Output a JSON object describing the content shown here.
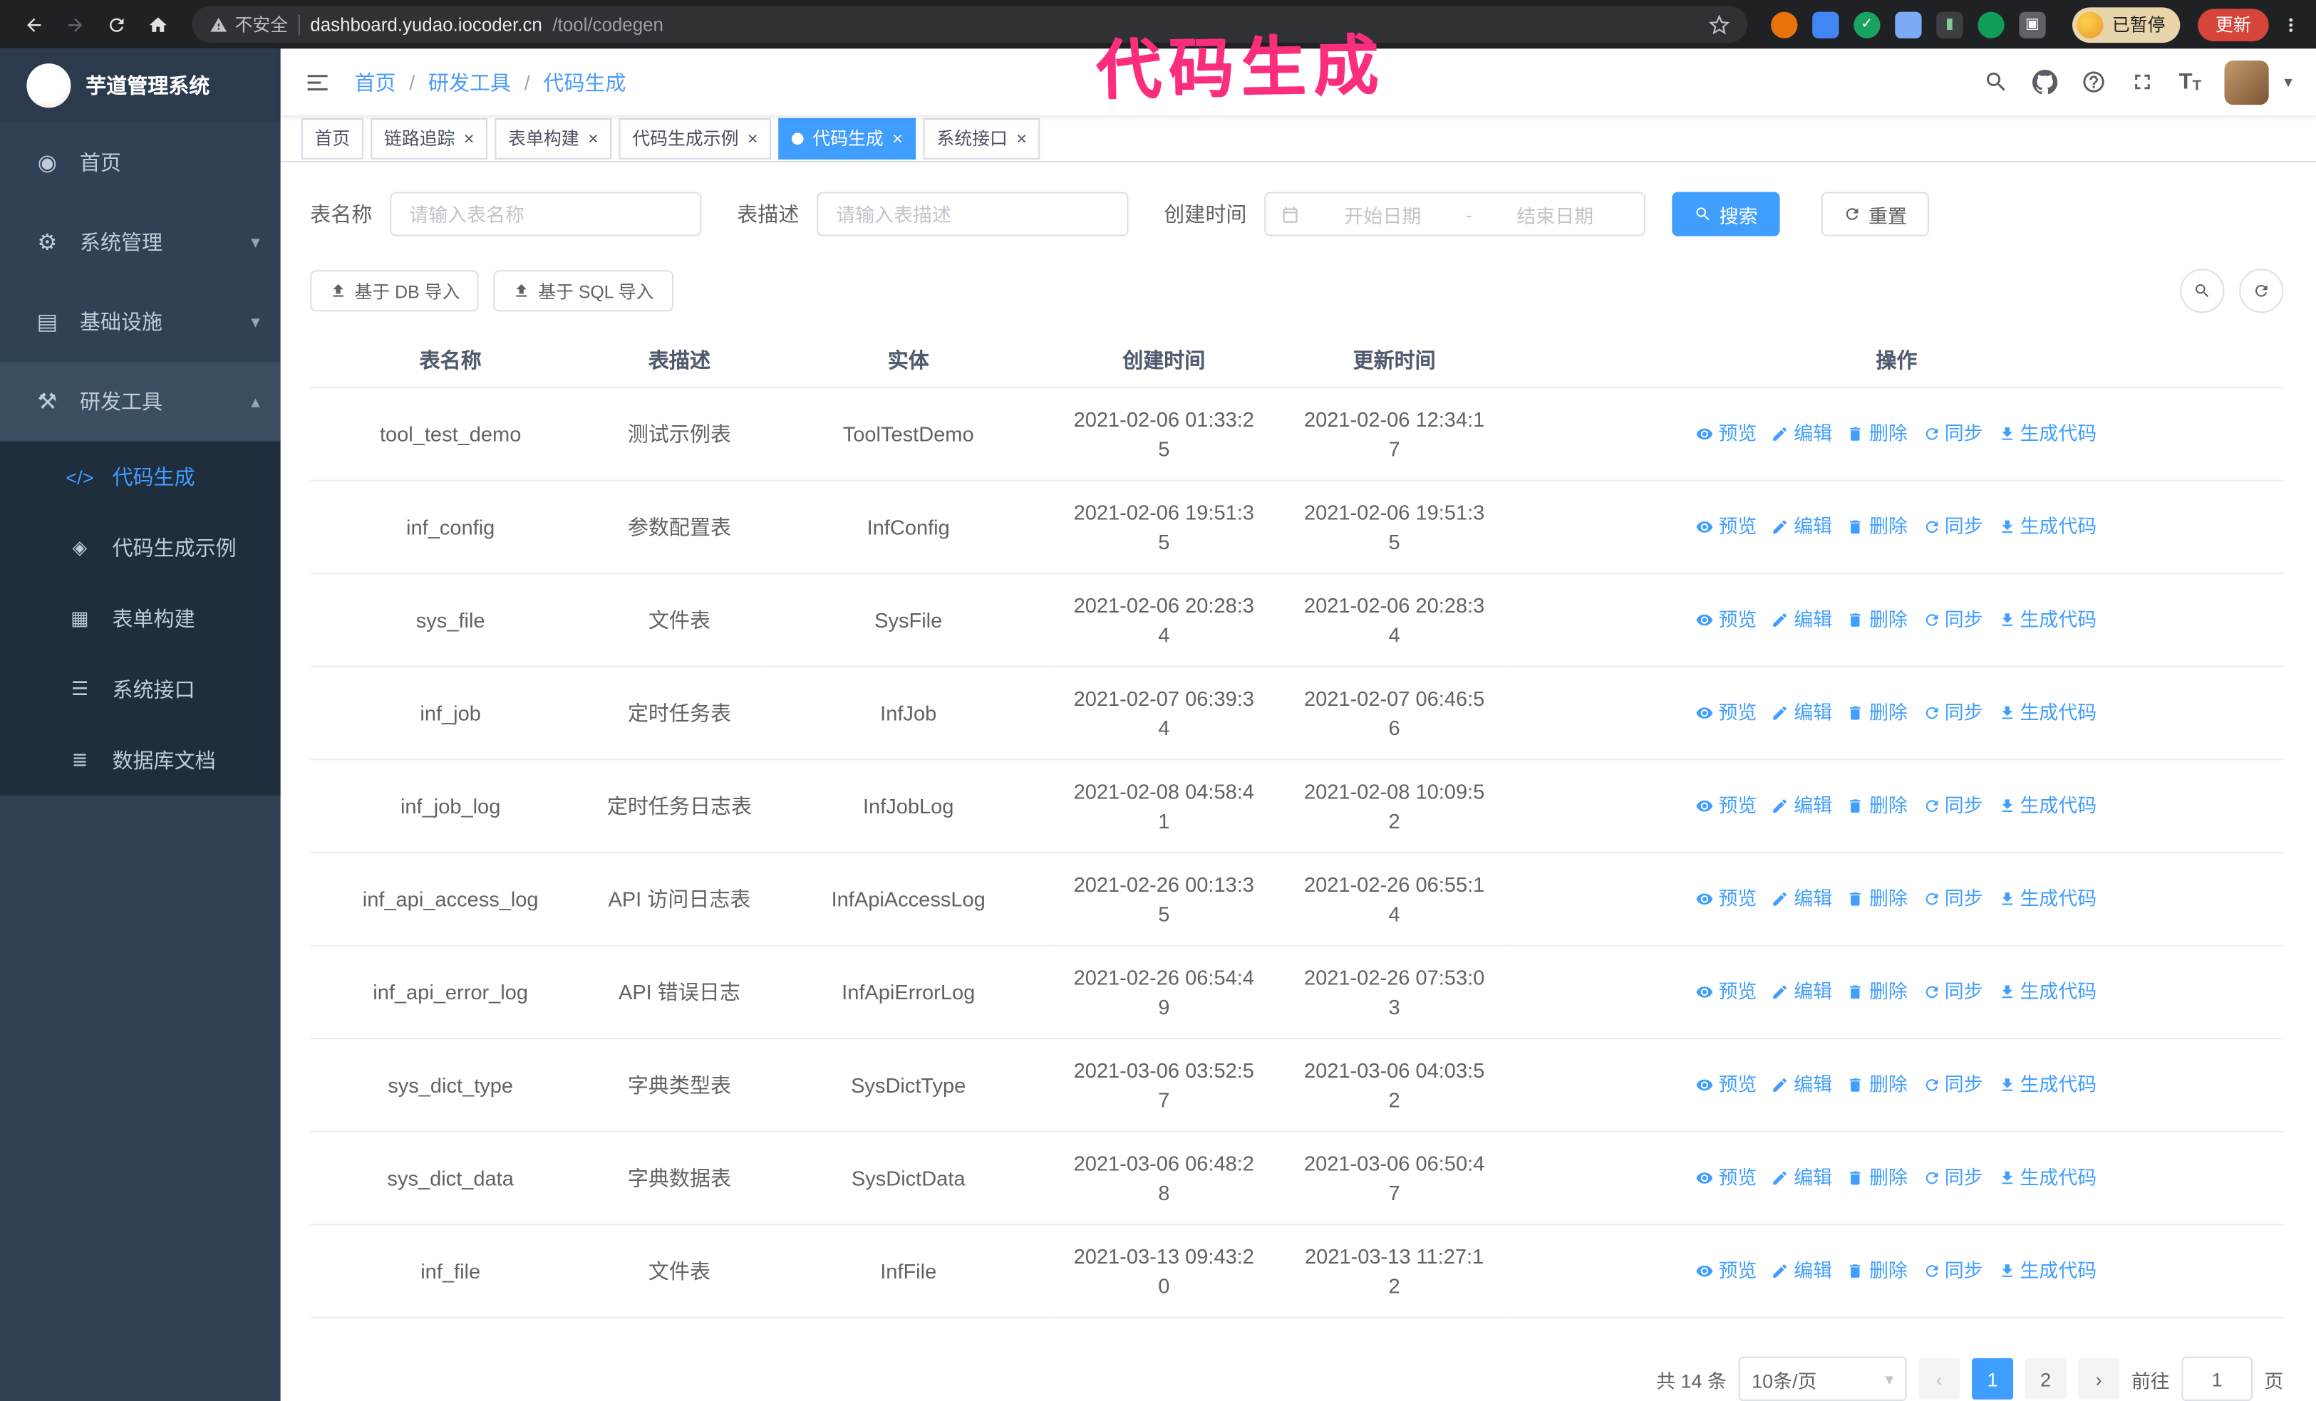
{
  "annotation": {
    "text": "代码生成",
    "color": "#fb2e7d"
  },
  "browser": {
    "security_label": "不安全",
    "url_host": "dashboard.yudao.iocoder.cn",
    "url_path": "/tool/codegen",
    "paused_badge": "已暂停",
    "update_button": "更新"
  },
  "sidebar": {
    "logo_title": "芋道管理系统",
    "items": [
      {
        "id": "home",
        "label": "首页",
        "icon": "dashboard-icon",
        "expandable": false,
        "expanded": false
      },
      {
        "id": "system",
        "label": "系统管理",
        "icon": "gear-icon",
        "expandable": true,
        "expanded": false
      },
      {
        "id": "infra",
        "label": "基础设施",
        "icon": "infra-icon",
        "expandable": true,
        "expanded": false
      },
      {
        "id": "devtools",
        "label": "研发工具",
        "icon": "tools-icon",
        "expandable": true,
        "expanded": true
      }
    ],
    "submenu": [
      {
        "id": "codegen",
        "label": "代码生成",
        "icon": "code-icon",
        "active": true
      },
      {
        "id": "codegen-example",
        "label": "代码生成示例",
        "icon": "example-icon",
        "active": false
      },
      {
        "id": "form-builder",
        "label": "表单构建",
        "icon": "form-icon",
        "active": false
      },
      {
        "id": "api",
        "label": "系统接口",
        "icon": "api-icon",
        "active": false
      },
      {
        "id": "db-doc",
        "label": "数据库文档",
        "icon": "db-doc-icon",
        "active": false
      }
    ]
  },
  "header": {
    "breadcrumb": [
      "首页",
      "研发工具",
      "代码生成"
    ],
    "separator": "/"
  },
  "tabs": [
    {
      "label": "首页",
      "closable": false,
      "active": false
    },
    {
      "label": "链路追踪",
      "closable": true,
      "active": false
    },
    {
      "label": "表单构建",
      "closable": true,
      "active": false
    },
    {
      "label": "代码生成示例",
      "closable": true,
      "active": false
    },
    {
      "label": "代码生成",
      "closable": true,
      "active": true
    },
    {
      "label": "系统接口",
      "closable": true,
      "active": false
    }
  ],
  "filters": {
    "table_name_label": "表名称",
    "table_name_placeholder": "请输入表名称",
    "table_desc_label": "表描述",
    "table_desc_placeholder": "请输入表描述",
    "create_time_label": "创建时间",
    "date_start_placeholder": "开始日期",
    "date_separator": "-",
    "date_end_placeholder": "结束日期",
    "search_button": "搜索",
    "reset_button": "重置"
  },
  "toolbar": {
    "import_db": "基于 DB 导入",
    "import_sql": "基于 SQL 导入"
  },
  "table": {
    "columns": [
      "表名称",
      "表描述",
      "实体",
      "创建时间",
      "更新时间",
      "操作"
    ],
    "ops": [
      {
        "name": "preview-link",
        "label": "预览",
        "icon": "eye-icon"
      },
      {
        "name": "edit-link",
        "label": "编辑",
        "icon": "edit-icon"
      },
      {
        "name": "delete-link",
        "label": "删除",
        "icon": "delete-icon"
      },
      {
        "name": "sync-link",
        "label": "同步",
        "icon": "sync-icon"
      },
      {
        "name": "generate-code-link",
        "label": "生成代码",
        "icon": "download-icon"
      }
    ],
    "rows": [
      {
        "name": "tool_test_demo",
        "desc": "测试示例表",
        "entity": "ToolTestDemo",
        "created": "2021-02-06 01:33:25",
        "updated": "2021-02-06 12:34:17"
      },
      {
        "name": "inf_config",
        "desc": "参数配置表",
        "entity": "InfConfig",
        "created": "2021-02-06 19:51:35",
        "updated": "2021-02-06 19:51:35"
      },
      {
        "name": "sys_file",
        "desc": "文件表",
        "entity": "SysFile",
        "created": "2021-02-06 20:28:34",
        "updated": "2021-02-06 20:28:34"
      },
      {
        "name": "inf_job",
        "desc": "定时任务表",
        "entity": "InfJob",
        "created": "2021-02-07 06:39:34",
        "updated": "2021-02-07 06:46:56"
      },
      {
        "name": "inf_job_log",
        "desc": "定时任务日志表",
        "entity": "InfJobLog",
        "created": "2021-02-08 04:58:41",
        "updated": "2021-02-08 10:09:52"
      },
      {
        "name": "inf_api_access_log",
        "desc": "API 访问日志表",
        "entity": "InfApiAccessLog",
        "created": "2021-02-26 00:13:35",
        "updated": "2021-02-26 06:55:14"
      },
      {
        "name": "inf_api_error_log",
        "desc": "API 错误日志",
        "entity": "InfApiErrorLog",
        "created": "2021-02-26 06:54:49",
        "updated": "2021-02-26 07:53:03"
      },
      {
        "name": "sys_dict_type",
        "desc": "字典类型表",
        "entity": "SysDictType",
        "created": "2021-03-06 03:52:57",
        "updated": "2021-03-06 04:03:52"
      },
      {
        "name": "sys_dict_data",
        "desc": "字典数据表",
        "entity": "SysDictData",
        "created": "2021-03-06 06:48:28",
        "updated": "2021-03-06 06:50:47"
      },
      {
        "name": "inf_file",
        "desc": "文件表",
        "entity": "InfFile",
        "created": "2021-03-13 09:43:20",
        "updated": "2021-03-13 11:27:12"
      }
    ]
  },
  "pagination": {
    "total": "共 14 条",
    "page_size": "10条/页",
    "pages": [
      "1",
      "2"
    ],
    "active_page": "1",
    "goto_label": "前往",
    "goto_value": "1",
    "goto_suffix": "页"
  }
}
